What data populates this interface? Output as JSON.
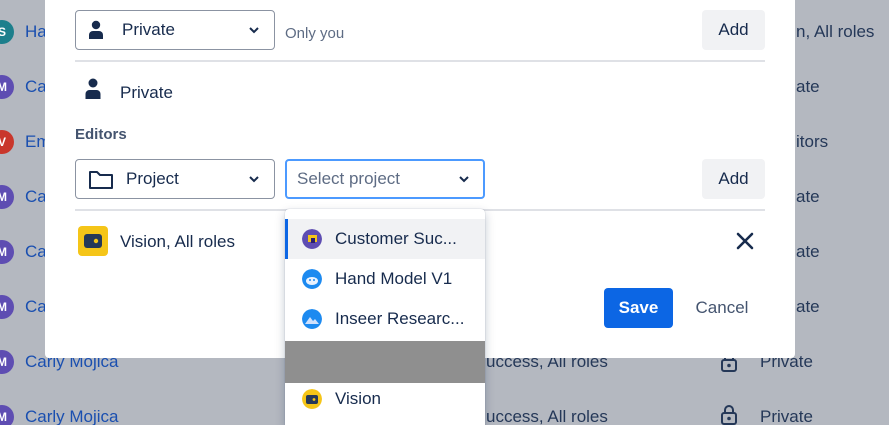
{
  "background": {
    "rows": [
      {
        "avatar_letter": "S",
        "avatar_color": "#1d7f8c",
        "name": "Ha",
        "mid": "",
        "right": "n, All roles"
      },
      {
        "avatar_letter": "M",
        "avatar_color": "#5e4db2",
        "name": "Ca",
        "mid": "",
        "right": "ate"
      },
      {
        "avatar_letter": "V",
        "avatar_color": "#c9372c",
        "name": "Em",
        "mid": "",
        "right": "itors"
      },
      {
        "avatar_letter": "M",
        "avatar_color": "#5e4db2",
        "name": "Ca",
        "mid": "",
        "right": "ate"
      },
      {
        "avatar_letter": "M",
        "avatar_color": "#5e4db2",
        "name": "Ca",
        "mid": "",
        "right": "ate"
      },
      {
        "avatar_letter": "M",
        "avatar_color": "#5e4db2",
        "name": "Ca",
        "mid": "",
        "right": "ate"
      },
      {
        "avatar_letter": "M",
        "avatar_color": "#5e4db2",
        "name": "Carly Mojica",
        "mid": "uccess, All roles",
        "access": "Private"
      },
      {
        "avatar_letter": "M",
        "avatar_color": "#5e4db2",
        "name": "Carly Mojica",
        "mid": "uccess, All roles",
        "access": "Private"
      }
    ]
  },
  "modal": {
    "viewers": {
      "select_value": "Private",
      "hint": "Only you",
      "add_label": "Add",
      "current": "Private"
    },
    "editors": {
      "label": "Editors",
      "type_select_value": "Project",
      "project_select_placeholder": "Select project",
      "add_label": "Add",
      "current": "Vision, All roles"
    },
    "save_label": "Save",
    "cancel_label": "Cancel"
  },
  "dropdown": {
    "items": [
      {
        "label": "Customer Suc...",
        "icon": "customer-success-icon",
        "active": true
      },
      {
        "label": "Hand Model V1",
        "icon": "hand-model-icon"
      },
      {
        "label": "Inseer Researc...",
        "icon": "inseer-research-icon"
      },
      {
        "label": "",
        "icon": ""
      },
      {
        "label": "Vision",
        "icon": "vision-icon"
      }
    ]
  },
  "colors": {
    "accent": "#0c66e4",
    "focus": "#4c9aff",
    "link": "#1a4fb0"
  }
}
